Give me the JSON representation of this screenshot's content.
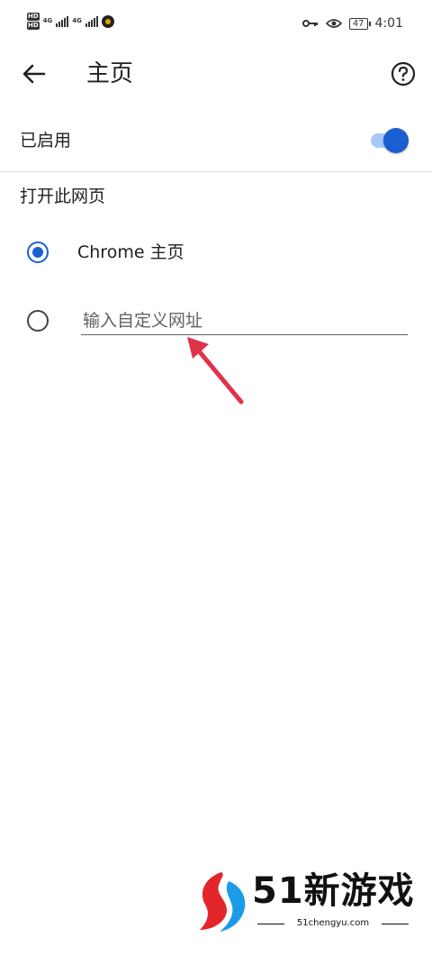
{
  "status_bar": {
    "sim1": {
      "hd": "HD",
      "net": "4G"
    },
    "sim2": {
      "hd": "HD",
      "net": "4G"
    },
    "battery": "47",
    "time": "4:01",
    "icons": [
      "key-icon",
      "eye-icon",
      "battery-icon"
    ]
  },
  "app_bar": {
    "back_icon": "arrow-back-icon",
    "title": "主页",
    "help_icon": "help-icon"
  },
  "enabled": {
    "label": "已启用",
    "toggle_on": true,
    "accent": "#1a5fd0"
  },
  "section": {
    "header": "打开此网页"
  },
  "options": {
    "chrome": {
      "label": "Chrome 主页",
      "selected": true
    },
    "custom": {
      "placeholder": "输入自定义网址",
      "value": "",
      "selected": false
    }
  },
  "annotation": {
    "arrow_color": "#e0334a"
  },
  "watermark": {
    "logo_text": "51新游戏",
    "url": "51chengyu.com"
  }
}
